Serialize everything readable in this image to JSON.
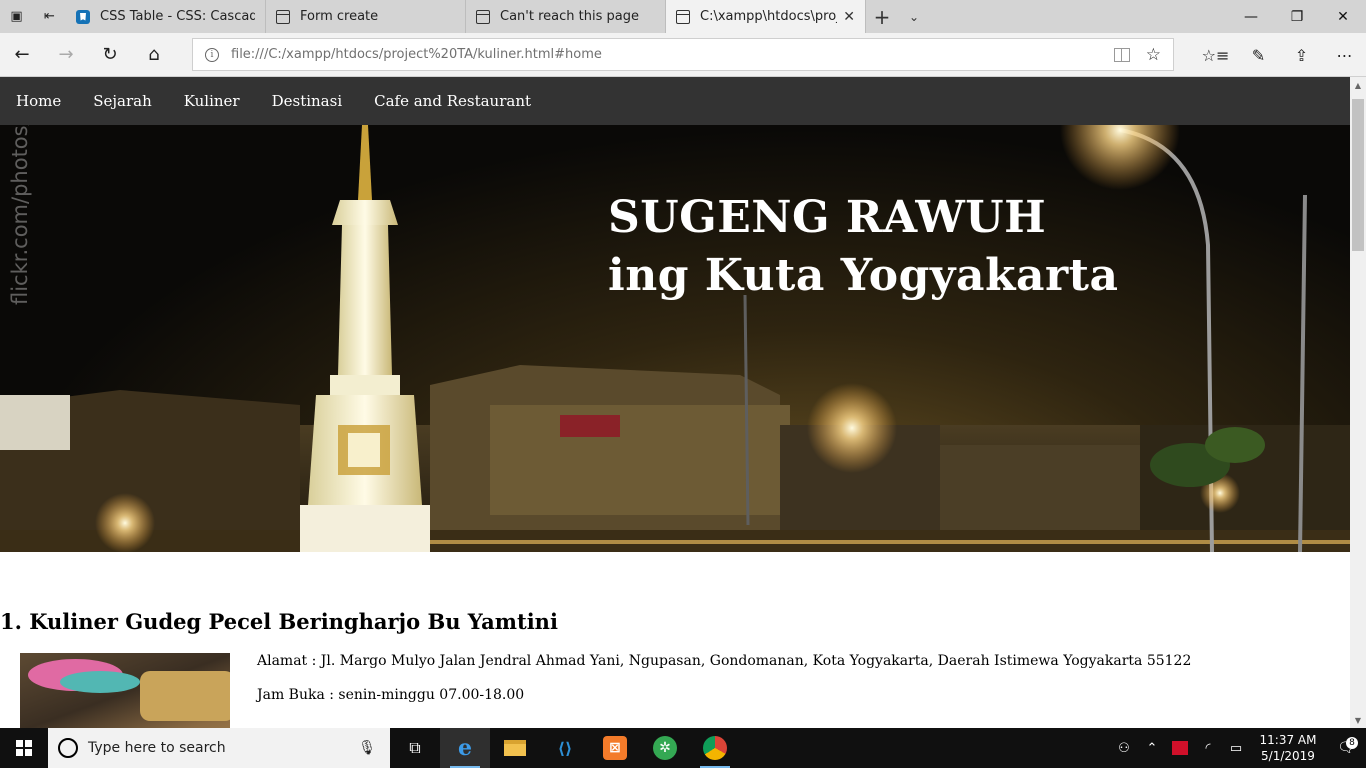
{
  "browser": {
    "tabs": [
      {
        "label": "CSS Table - CSS: Cascading",
        "icon": "css-favicon-icon"
      },
      {
        "label": "Form create",
        "icon": "page-icon"
      },
      {
        "label": "Can't reach this page",
        "icon": "page-icon"
      },
      {
        "label": "C:\\xampp\\htdocs\\proje",
        "icon": "page-icon",
        "active": true
      }
    ],
    "url": "file:///C:/xampp/htdocs/project%20TA/kuliner.html#home"
  },
  "site": {
    "nav": [
      "Home",
      "Sejarah",
      "Kuliner",
      "Destinasi",
      "Cafe and Restaurant"
    ],
    "hero": {
      "title_line1": "SUGENG RAWUH",
      "title_line2": "ing Kuta Yogyakarta",
      "watermark": "flickr.com/photos/y"
    },
    "entries": [
      {
        "heading": "1. Kuliner Gudeg Pecel Beringharjo Bu Yamtini",
        "alamat": "Alamat : Jl. Margo Mulyo Jalan Jendral Ahmad Yani, Ngupasan, Gondomanan, Kota Yogyakarta, Daerah Istimewa Yogyakarta 55122",
        "jam_buka": "Jam Buka : senin-minggu 07.00-18.00"
      }
    ]
  },
  "taskbar": {
    "search_placeholder": "Type here to search",
    "time": "11:37 AM",
    "date": "5/1/2019",
    "notification_count": "8"
  }
}
